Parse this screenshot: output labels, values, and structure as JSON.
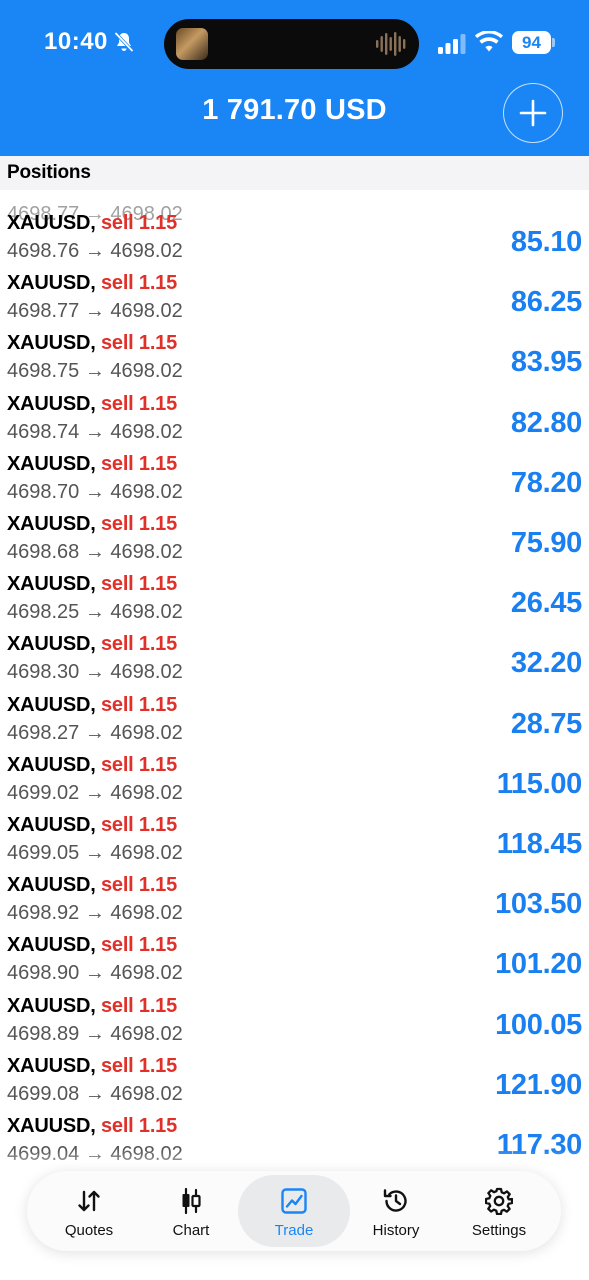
{
  "status_bar": {
    "time": "10:40",
    "battery": "94"
  },
  "header": {
    "balance": "1 791.70 USD"
  },
  "section": {
    "title": "Positions"
  },
  "partial_row": {
    "text": "4698.77 → 4698.02"
  },
  "positions": [
    {
      "symbol": "XAUUSD,",
      "side": "sell 1.15",
      "prices": "4698.76 → 4698.02",
      "profit": "85.10"
    },
    {
      "symbol": "XAUUSD,",
      "side": "sell 1.15",
      "prices": "4698.77 → 4698.02",
      "profit": "86.25"
    },
    {
      "symbol": "XAUUSD,",
      "side": "sell 1.15",
      "prices": "4698.75 → 4698.02",
      "profit": "83.95"
    },
    {
      "symbol": "XAUUSD,",
      "side": "sell 1.15",
      "prices": "4698.74 → 4698.02",
      "profit": "82.80"
    },
    {
      "symbol": "XAUUSD,",
      "side": "sell 1.15",
      "prices": "4698.70 → 4698.02",
      "profit": "78.20"
    },
    {
      "symbol": "XAUUSD,",
      "side": "sell 1.15",
      "prices": "4698.68 → 4698.02",
      "profit": "75.90"
    },
    {
      "symbol": "XAUUSD,",
      "side": "sell 1.15",
      "prices": "4698.25 → 4698.02",
      "profit": "26.45"
    },
    {
      "symbol": "XAUUSD,",
      "side": "sell 1.15",
      "prices": "4698.30 → 4698.02",
      "profit": "32.20"
    },
    {
      "symbol": "XAUUSD,",
      "side": "sell 1.15",
      "prices": "4698.27 → 4698.02",
      "profit": "28.75"
    },
    {
      "symbol": "XAUUSD,",
      "side": "sell 1.15",
      "prices": "4699.02 → 4698.02",
      "profit": "115.00"
    },
    {
      "symbol": "XAUUSD,",
      "side": "sell 1.15",
      "prices": "4699.05 → 4698.02",
      "profit": "118.45"
    },
    {
      "symbol": "XAUUSD,",
      "side": "sell 1.15",
      "prices": "4698.92 → 4698.02",
      "profit": "103.50"
    },
    {
      "symbol": "XAUUSD,",
      "side": "sell 1.15",
      "prices": "4698.90 → 4698.02",
      "profit": "101.20"
    },
    {
      "symbol": "XAUUSD,",
      "side": "sell 1.15",
      "prices": "4698.89 → 4698.02",
      "profit": "100.05"
    },
    {
      "symbol": "XAUUSD,",
      "side": "sell 1.15",
      "prices": "4699.08 → 4698.02",
      "profit": "121.90"
    },
    {
      "symbol": "XAUUSD,",
      "side": "sell 1.15",
      "prices": "4699.04 → 4698.02",
      "profit": "117.30"
    }
  ],
  "tabs": [
    {
      "label": "Quotes",
      "icon": "quotes-arrows-icon"
    },
    {
      "label": "Chart",
      "icon": "candlestick-icon"
    },
    {
      "label": "Trade",
      "icon": "trade-chart-icon",
      "active": true
    },
    {
      "label": "History",
      "icon": "history-clock-icon"
    },
    {
      "label": "Settings",
      "icon": "gear-icon"
    }
  ],
  "colors": {
    "accent": "#1a86f5",
    "sell": "#e0302a",
    "profit": "#1a7ff0"
  }
}
